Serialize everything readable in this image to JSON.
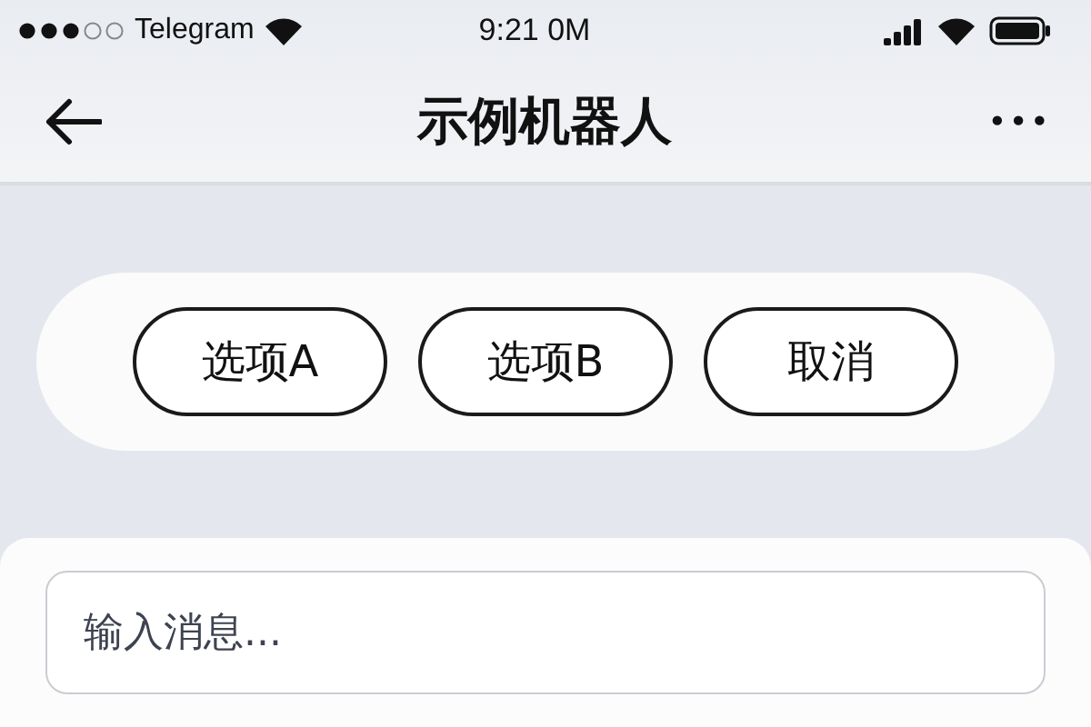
{
  "status_bar": {
    "carrier": "Telegram",
    "time": "9:21 0M"
  },
  "nav": {
    "title": "示例机器人",
    "more": "•••"
  },
  "keyboard": {
    "buttons": [
      {
        "label": "选项A"
      },
      {
        "label": "选项B"
      },
      {
        "label": "取消"
      }
    ]
  },
  "composer": {
    "placeholder": "输入消息..."
  }
}
